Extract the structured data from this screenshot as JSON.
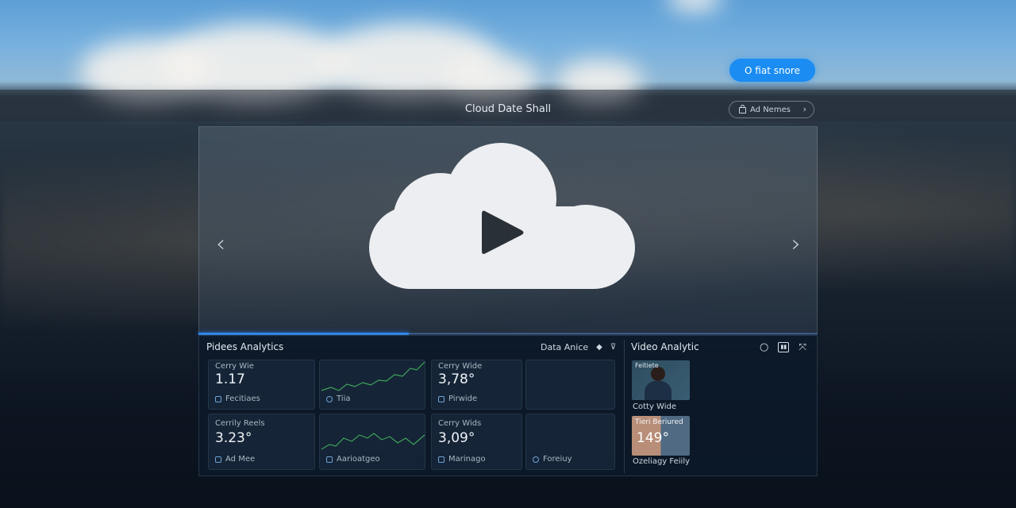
{
  "header": {
    "primary_button": "O fiat snore",
    "title": "Cloud Date Shall",
    "secondary_button": "Ad Nemes"
  },
  "player": {
    "progress": 0.34
  },
  "analytics": {
    "title": "Pidees Analytics",
    "filter_label": "Data Anice",
    "cards": [
      {
        "label": "Cerry Wie",
        "value": "1.17",
        "footer": "Fecitiaes"
      },
      {
        "footer": "Tiia"
      },
      {
        "label": "Cerry Wide",
        "value": "3,78°",
        "footer": "Pirwide"
      },
      {
        "label": "Cerrily Reels",
        "value": "3.23°",
        "footer": "Ad Mee"
      },
      {
        "footer": "Aarioatgeo"
      },
      {
        "label": "Cerry Wids",
        "value": "3,09°",
        "footer": "Marinago"
      },
      {
        "footer": "Foreiuy"
      }
    ]
  },
  "video_analytics": {
    "title": "Video Analytic",
    "thumb1_caption": "Feitiete",
    "thumb1_label": "Cotty Wide",
    "thumb2_caption": "Tieri Beriured",
    "thumb2_value": "149°",
    "thumb2_label": "Ozeliagy Feiily"
  },
  "colors": {
    "accent": "#1a8cf2",
    "chart_line": "#3fa35a"
  },
  "icons": [
    "lock-icon",
    "chevron-right-icon",
    "chevron-left-icon",
    "play-icon",
    "cloud-icon",
    "diamond-icon",
    "filter-icon",
    "circle-icon",
    "grid-icon",
    "expand-icon",
    "calendar-icon",
    "clock-icon"
  ]
}
